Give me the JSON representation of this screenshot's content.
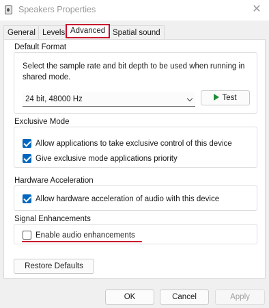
{
  "window": {
    "title": "Speakers Properties"
  },
  "tabs": [
    {
      "label": "General"
    },
    {
      "label": "Levels"
    },
    {
      "label": "Advanced"
    },
    {
      "label": "Spatial sound"
    }
  ],
  "default_format": {
    "title": "Default Format",
    "description": "Select the sample rate and bit depth to be used when running in shared mode.",
    "selected": "24 bit, 48000 Hz",
    "test_label": "Test"
  },
  "exclusive_mode": {
    "title": "Exclusive Mode",
    "options": [
      {
        "label": "Allow applications to take exclusive control of this device",
        "checked": true
      },
      {
        "label": "Give exclusive mode applications priority",
        "checked": true
      }
    ]
  },
  "hardware_acceleration": {
    "title": "Hardware Acceleration",
    "options": [
      {
        "label": "Allow hardware acceleration of audio with this device",
        "checked": true
      }
    ]
  },
  "signal_enhancements": {
    "title": "Signal Enhancements",
    "options": [
      {
        "label": "Enable audio enhancements",
        "checked": false
      }
    ]
  },
  "restore_label": "Restore Defaults",
  "footer": {
    "ok": "OK",
    "cancel": "Cancel",
    "apply": "Apply"
  },
  "colors": {
    "highlight": "#c8102e",
    "checkbox": "#0067c0",
    "test_icon": "#1e8a3a"
  }
}
